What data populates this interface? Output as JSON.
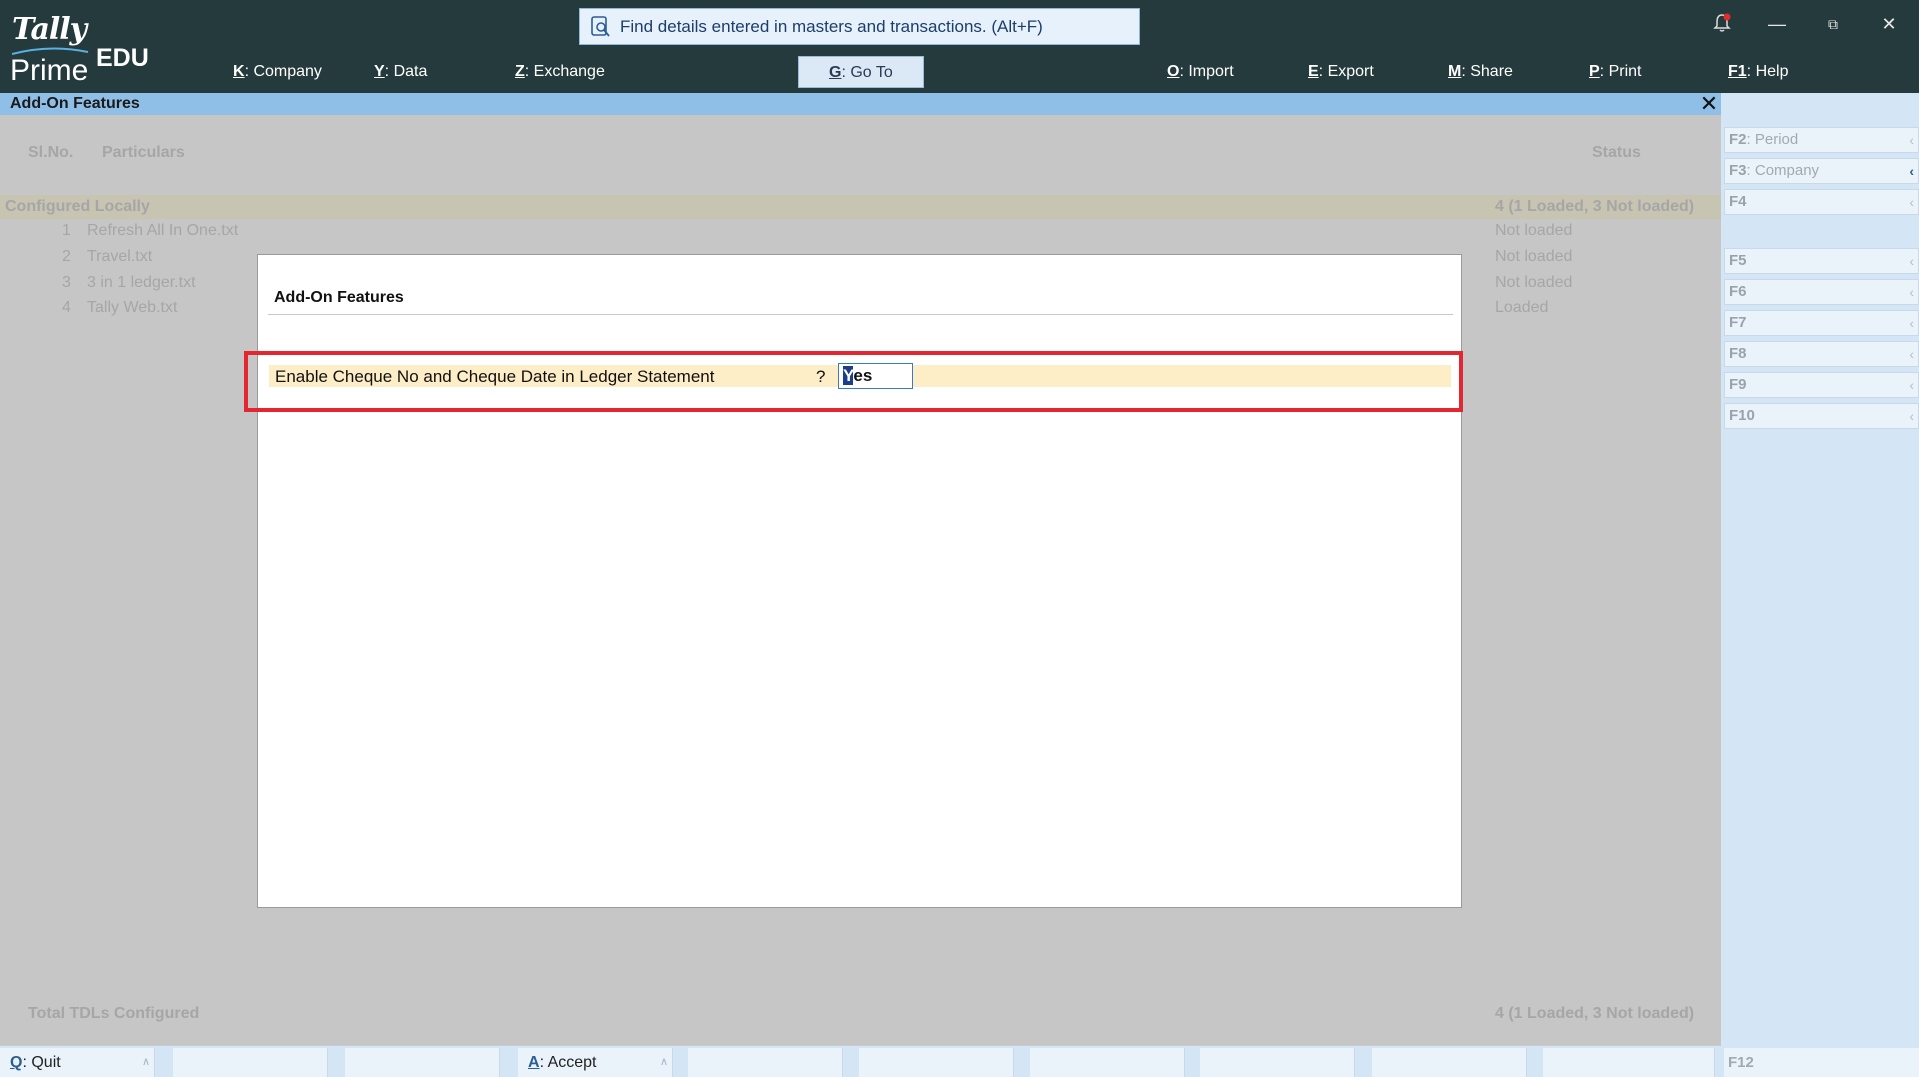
{
  "app": {
    "logo_top": "Tally",
    "logo_bottom": "Prime",
    "edition": "EDU"
  },
  "search": {
    "placeholder": "Find details entered in masters and transactions. (Alt+F)"
  },
  "menu": [
    {
      "key": "K",
      "label": "Company"
    },
    {
      "key": "Y",
      "label": "Data"
    },
    {
      "key": "Z",
      "label": "Exchange"
    },
    {
      "key": "G",
      "label": "Go To"
    },
    {
      "key": "O",
      "label": "Import"
    },
    {
      "key": "E",
      "label": "Export"
    },
    {
      "key": "M",
      "label": "Share"
    },
    {
      "key": "P",
      "label": "Print"
    },
    {
      "key": "F1",
      "label": "Help"
    }
  ],
  "screen": {
    "title": "Add-On Features"
  },
  "report": {
    "col_slno": "Sl.No.",
    "col_particulars": "Particulars",
    "col_status": "Status",
    "group_label": "Configured Locally",
    "group_status": "4 (1 Loaded, 3 Not loaded)",
    "rows": [
      {
        "no": "1",
        "name": "Refresh All In One.txt",
        "status": "Not loaded"
      },
      {
        "no": "2",
        "name": "Travel.txt",
        "status": "Not loaded"
      },
      {
        "no": "3",
        "name": "3 in 1 ledger.txt",
        "status": "Not loaded"
      },
      {
        "no": "4",
        "name": "Tally Web.txt",
        "status": "Loaded"
      }
    ],
    "total_label": "Total TDLs Configured",
    "total_status": "4 (1 Loaded, 3 Not loaded)"
  },
  "right_panel": [
    {
      "key": "F2",
      "label": "Period"
    },
    {
      "key": "F3",
      "label": "Company"
    },
    {
      "key": "F4",
      "label": ""
    },
    {
      "key": "F5",
      "label": ""
    },
    {
      "key": "F6",
      "label": ""
    },
    {
      "key": "F7",
      "label": ""
    },
    {
      "key": "F8",
      "label": ""
    },
    {
      "key": "F9",
      "label": ""
    },
    {
      "key": "F10",
      "label": ""
    }
  ],
  "bottom_bar": {
    "quit_key": "Q",
    "quit_label": "Quit",
    "accept_key": "A",
    "accept_label": "Accept",
    "f12": "F12"
  },
  "dialog": {
    "title": "Add-On Features",
    "option_label": "Enable Cheque No and Cheque Date in Ledger Statement",
    "option_q": "?",
    "value_first": "Y",
    "value_rest": "es"
  }
}
